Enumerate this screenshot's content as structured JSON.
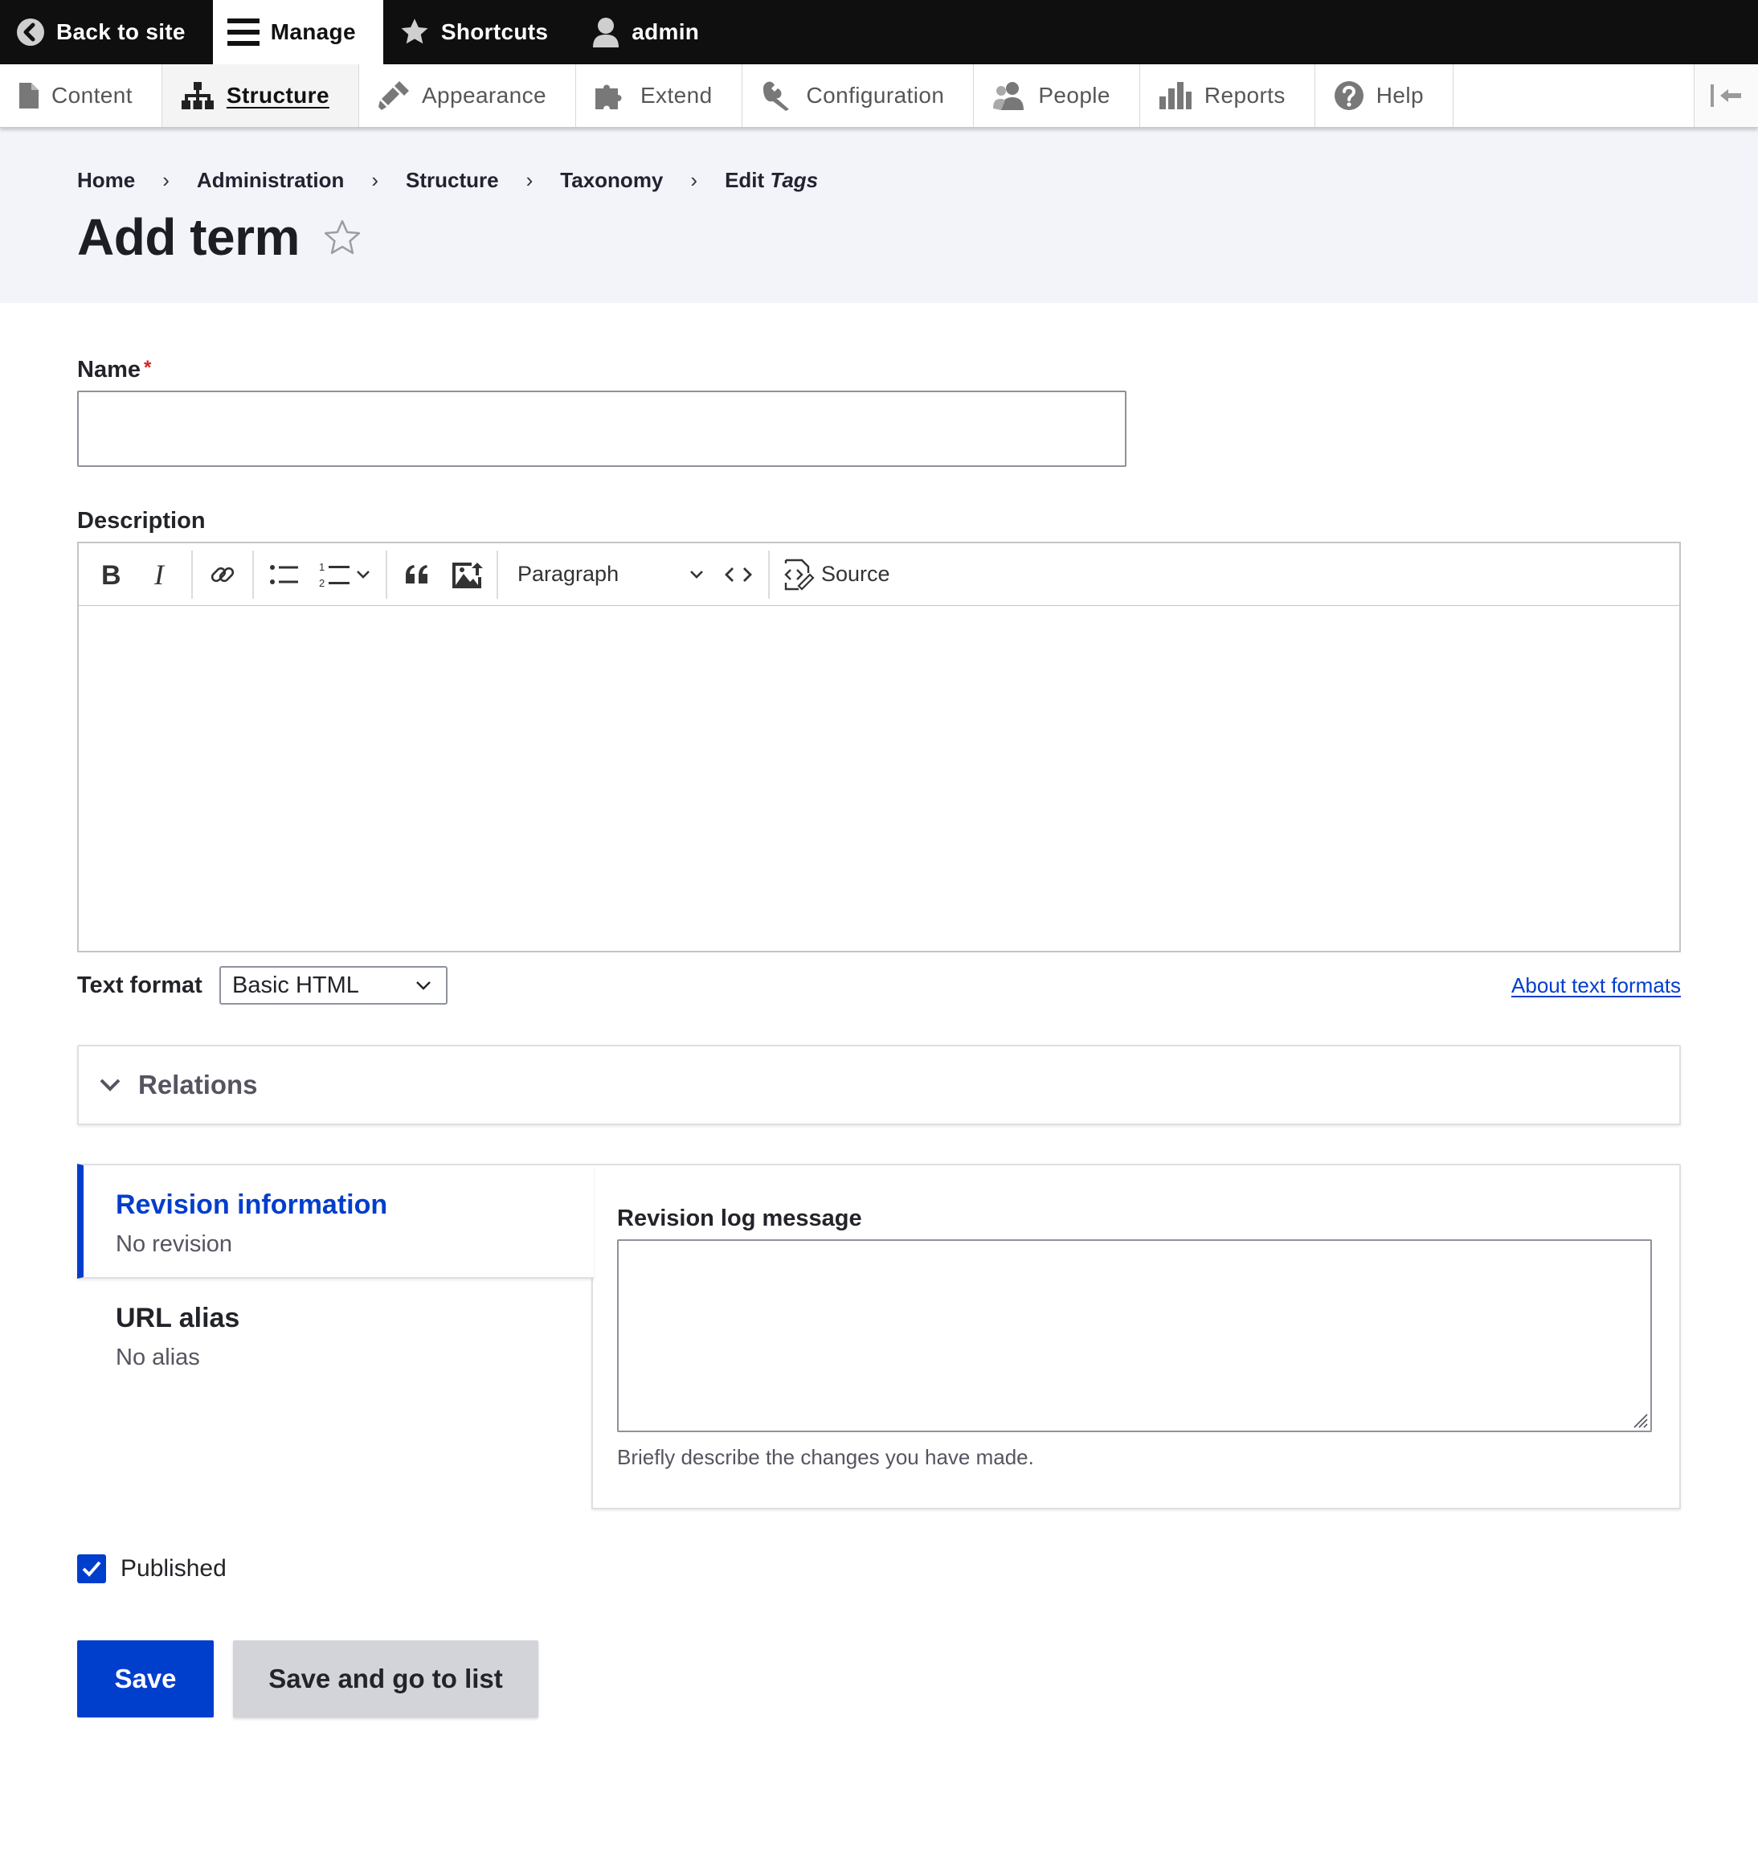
{
  "toolbar": {
    "back_to_site": "Back to site",
    "manage": "Manage",
    "shortcuts": "Shortcuts",
    "user": "admin"
  },
  "tray": {
    "items": [
      {
        "label": "Content",
        "icon": "file-icon"
      },
      {
        "label": "Structure",
        "icon": "sitemap-icon",
        "active": true
      },
      {
        "label": "Appearance",
        "icon": "paintbrush-icon"
      },
      {
        "label": "Extend",
        "icon": "puzzle-icon"
      },
      {
        "label": "Configuration",
        "icon": "wrench-icon"
      },
      {
        "label": "People",
        "icon": "people-icon"
      },
      {
        "label": "Reports",
        "icon": "bar-chart-icon"
      },
      {
        "label": "Help",
        "icon": "help-icon"
      }
    ],
    "collapse_icon": "collapse-orientation-icon"
  },
  "breadcrumb": {
    "items": [
      "Home",
      "Administration",
      "Structure",
      "Taxonomy"
    ],
    "last_prefix": "Edit",
    "last_em": "Tags"
  },
  "page": {
    "title": "Add term",
    "star_icon": "star-outline-icon"
  },
  "form": {
    "name_label": "Name",
    "name_required_marker": "*",
    "name_value": "",
    "description_label": "Description",
    "editor": {
      "heading_select": "Paragraph",
      "source_label": "Source",
      "tools": [
        "bold-icon",
        "italic-icon",
        "link-icon",
        "bulleted-list-icon",
        "numbered-list-icon",
        "blockquote-icon",
        "image-upload-icon",
        "code-icon",
        "source-icon"
      ]
    },
    "text_format_label": "Text format",
    "text_format_value": "Basic HTML",
    "about_text_formats": "About text formats",
    "relations_label": "Relations",
    "vertical_tabs": [
      {
        "title": "Revision information",
        "summary": "No revision",
        "active": true
      },
      {
        "title": "URL alias",
        "summary": "No alias",
        "active": false
      }
    ],
    "revision_log_label": "Revision log message",
    "revision_log_value": "",
    "revision_log_help": "Briefly describe the changes you have made.",
    "published_label": "Published",
    "published_checked": true,
    "save_label": "Save",
    "save_list_label": "Save and go to list"
  },
  "colors": {
    "accent": "#003ecc",
    "toolbar_bg": "#0f0f0f",
    "header_bg": "#f3f4f9",
    "required": "#d72222"
  }
}
